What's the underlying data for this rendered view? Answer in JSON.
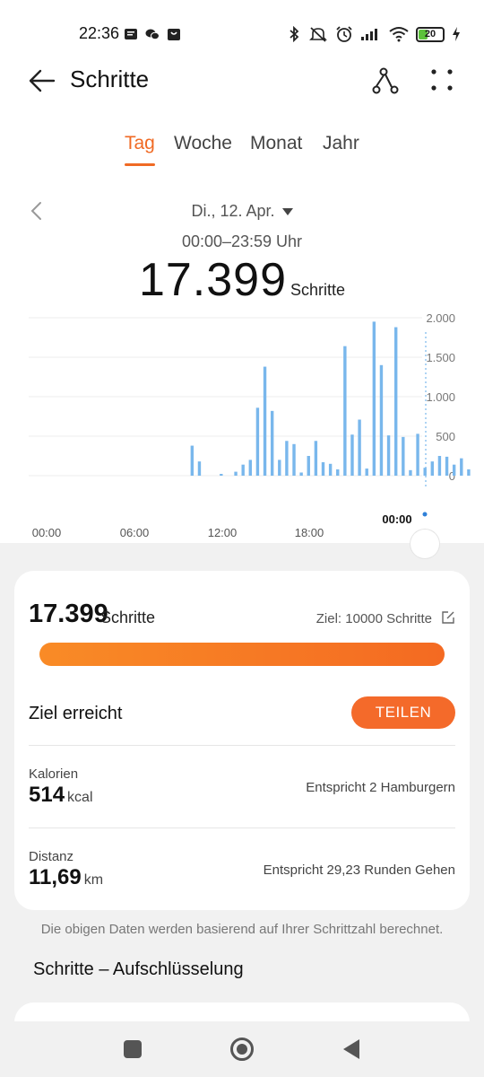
{
  "status_bar": {
    "time": "22:36",
    "battery": "20",
    "left_icons": [
      "message-icon",
      "wechat-icon",
      "shopping-bag-icon"
    ],
    "right_icons": [
      "bluetooth-icon",
      "mute-icon",
      "alarm-icon",
      "signal-icon",
      "wifi-icon",
      "battery-icon",
      "charging-icon"
    ]
  },
  "header": {
    "title": "Schritte",
    "back_icon": "arrow-left-icon",
    "route_icon": "route-icon",
    "more_icon": "more-dots-icon"
  },
  "tabs": [
    {
      "label": "Tag",
      "active": true
    },
    {
      "label": "Woche",
      "active": false
    },
    {
      "label": "Monat",
      "active": false
    },
    {
      "label": "Jahr",
      "active": false
    }
  ],
  "date": {
    "label": "Di., 12. Apr.",
    "time_range": "00:00–23:59 Uhr"
  },
  "total": {
    "value": "17.399",
    "unit": "Schritte"
  },
  "chart_data": {
    "type": "bar",
    "x_ticks": [
      "00:00",
      "06:00",
      "12:00",
      "18:00"
    ],
    "selected_time_label": "00:00",
    "y_ticks": [
      "2.000",
      "1.500",
      "1.000",
      "500",
      "0"
    ],
    "ylim": [
      0,
      2000
    ],
    "grid": true,
    "bar_color": "#79b7ec",
    "bucket_minutes": 30,
    "values": [
      0,
      0,
      0,
      0,
      0,
      0,
      0,
      0,
      0,
      0,
      0,
      0,
      0,
      0,
      0,
      0,
      0,
      0,
      0,
      0,
      0,
      0,
      380,
      180,
      0,
      0,
      20,
      0,
      50,
      140,
      200,
      860,
      1380,
      820,
      200,
      440,
      400,
      40,
      250,
      440,
      170,
      150,
      80,
      1640,
      520,
      710,
      90,
      1950,
      1400,
      510,
      1880,
      490,
      70,
      530,
      100,
      180,
      250,
      240,
      140,
      220,
      80
    ]
  },
  "summary": {
    "steps_value": "17.399",
    "steps_unit": "Schritte",
    "goal_text": "Ziel: 10000 Schritte",
    "progress_fraction": 1.0,
    "goal_reached": "Ziel erreicht",
    "share_label": "TEILEN",
    "calories": {
      "label": "Kalorien",
      "value": "514",
      "unit": "kcal",
      "equivalent": "Entspricht 2 Hamburgern"
    },
    "distance": {
      "label": "Distanz",
      "value": "11,69",
      "unit": "km",
      "equivalent": "Entspricht 29,23 Runden Gehen"
    }
  },
  "footnote": "Die obigen Daten werden basierend auf Ihrer Schrittzahl berechnet.",
  "breakdown_title": "Schritte – Aufschlüsselung",
  "accent_color": "#f06a24"
}
